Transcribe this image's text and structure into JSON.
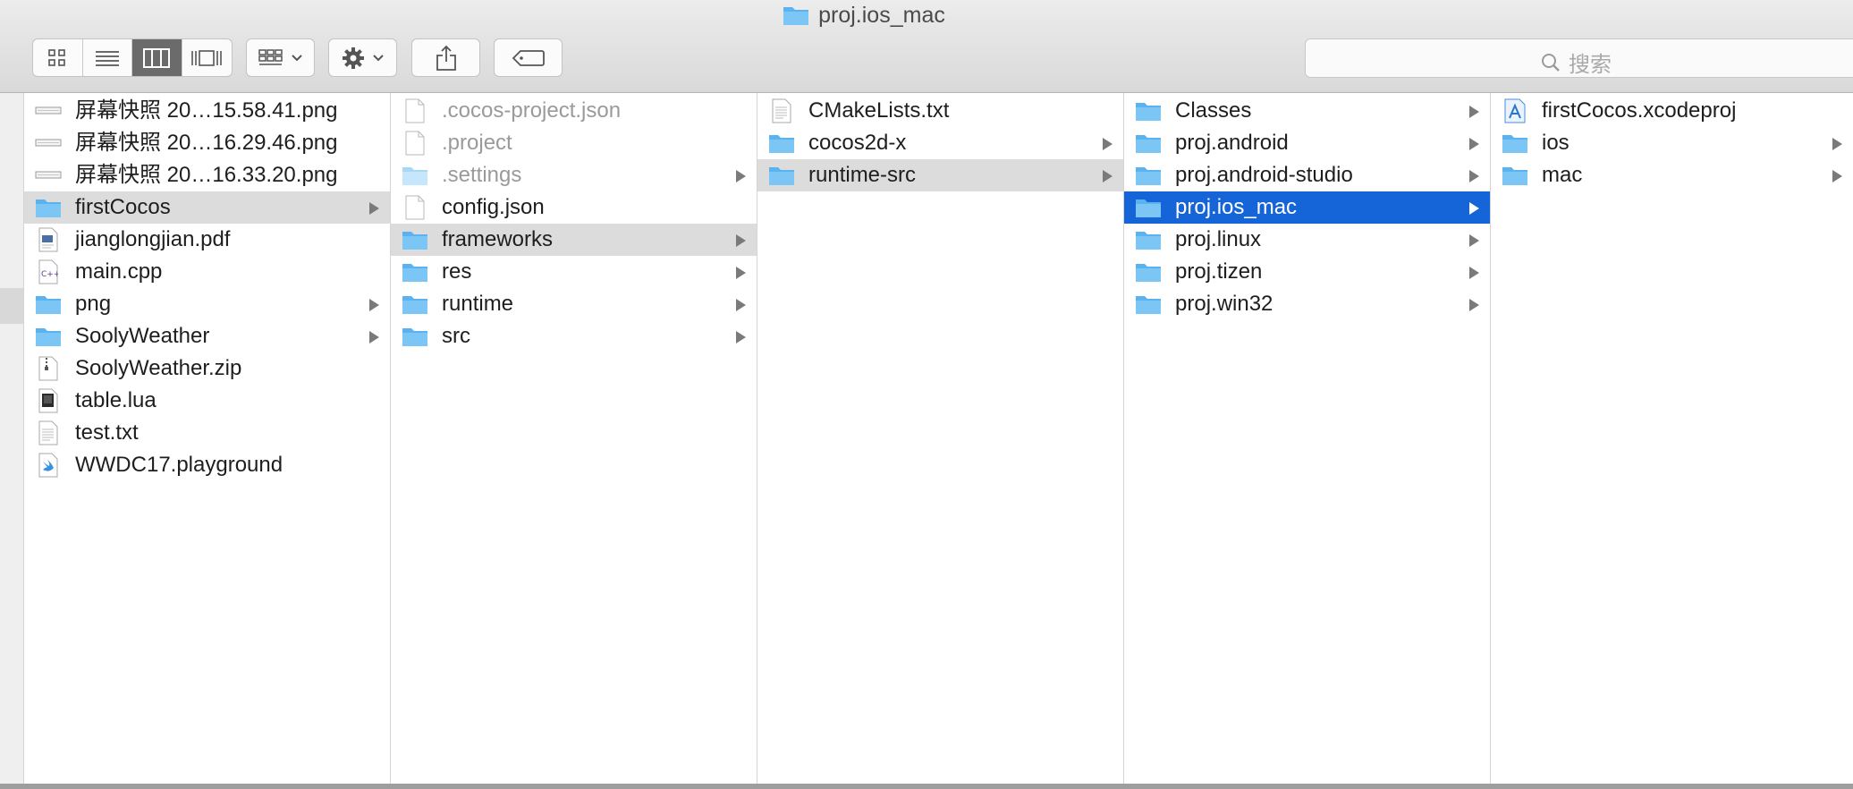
{
  "window": {
    "title": "proj.ios_mac"
  },
  "toolbar": {
    "view_buttons": [
      "icon-view-icon",
      "list-view-icon",
      "column-view-icon",
      "cover-flow-view-icon"
    ],
    "active_view": "column-view-icon",
    "arrange_icon": "arrange-grid-icon",
    "action_icon": "gear-icon",
    "share_icon": "share-icon",
    "tag_icon": "tag-icon",
    "search_placeholder": "搜索",
    "search_icon": "search-icon"
  },
  "colors": {
    "selection_blue": "#1665d8",
    "selection_grey": "#dcdcdc",
    "folder": "#5ab3ef"
  },
  "columns": [
    {
      "items": [
        {
          "name": "屏幕快照 20…15.58.41.png",
          "kind": "image"
        },
        {
          "name": "屏幕快照 20…16.29.46.png",
          "kind": "image"
        },
        {
          "name": "屏幕快照 20…16.33.20.png",
          "kind": "image"
        },
        {
          "name": "firstCocos",
          "kind": "folder",
          "arrow": true,
          "selected": "grey"
        },
        {
          "name": "jianglongjian.pdf",
          "kind": "pdf"
        },
        {
          "name": "main.cpp",
          "kind": "cpp"
        },
        {
          "name": "png",
          "kind": "folder",
          "arrow": true
        },
        {
          "name": "SoolyWeather",
          "kind": "folder",
          "arrow": true
        },
        {
          "name": "SoolyWeather.zip",
          "kind": "zip"
        },
        {
          "name": "table.lua",
          "kind": "lua"
        },
        {
          "name": "test.txt",
          "kind": "text"
        },
        {
          "name": "WWDC17.playground",
          "kind": "swift"
        }
      ]
    },
    {
      "items": [
        {
          "name": ".cocos-project.json",
          "kind": "blank",
          "dim": true
        },
        {
          "name": ".project",
          "kind": "blank",
          "dim": true
        },
        {
          "name": ".settings",
          "kind": "folder-light",
          "dim": true,
          "arrow": true
        },
        {
          "name": "config.json",
          "kind": "blank"
        },
        {
          "name": "frameworks",
          "kind": "folder",
          "arrow": true,
          "selected": "grey"
        },
        {
          "name": "res",
          "kind": "folder",
          "arrow": true
        },
        {
          "name": "runtime",
          "kind": "folder",
          "arrow": true
        },
        {
          "name": "src",
          "kind": "folder",
          "arrow": true
        }
      ]
    },
    {
      "items": [
        {
          "name": "CMakeLists.txt",
          "kind": "text"
        },
        {
          "name": "cocos2d-x",
          "kind": "folder",
          "arrow": true
        },
        {
          "name": "runtime-src",
          "kind": "folder",
          "arrow": true,
          "selected": "grey"
        }
      ]
    },
    {
      "items": [
        {
          "name": "Classes",
          "kind": "folder",
          "arrow": true
        },
        {
          "name": "proj.android",
          "kind": "folder",
          "arrow": true
        },
        {
          "name": "proj.android-studio",
          "kind": "folder",
          "arrow": true
        },
        {
          "name": "proj.ios_mac",
          "kind": "folder",
          "arrow": true,
          "selected": "blue"
        },
        {
          "name": "proj.linux",
          "kind": "folder",
          "arrow": true
        },
        {
          "name": "proj.tizen",
          "kind": "folder",
          "arrow": true
        },
        {
          "name": "proj.win32",
          "kind": "folder",
          "arrow": true
        }
      ]
    },
    {
      "items": [
        {
          "name": "firstCocos.xcodeproj",
          "kind": "xcodeproj"
        },
        {
          "name": "ios",
          "kind": "folder",
          "arrow": true
        },
        {
          "name": "mac",
          "kind": "folder",
          "arrow": true
        }
      ]
    }
  ]
}
